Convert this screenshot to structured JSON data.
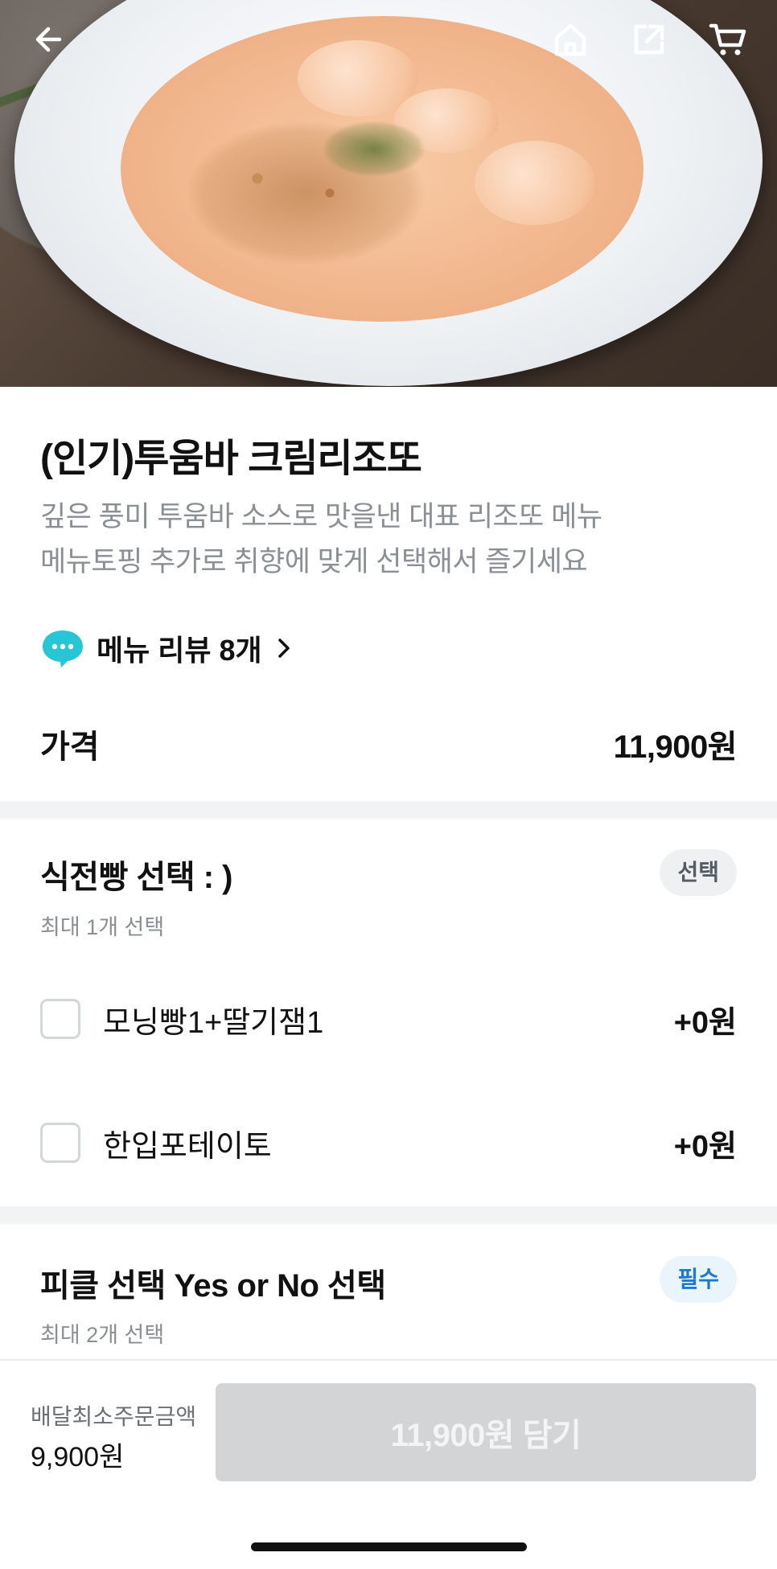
{
  "header": {
    "back_icon": "arrow-left-icon",
    "home_icon": "home-icon",
    "share_icon": "share-external-icon",
    "cart_icon": "cart-icon"
  },
  "product": {
    "title": "(인기)투움바 크림리조또",
    "description_lines": [
      "깊은 풍미 투움바 소스로 맛을낸 대표 리조또 메뉴",
      "메뉴토핑 추가로  취향에 맞게 선택해서 즐기세요"
    ],
    "review_label": "메뉴 리뷰 8개",
    "price_label": "가격",
    "price_value": "11,900원"
  },
  "option_groups": [
    {
      "title": "식전빵 선택 : )",
      "subtitle": "최대 1개 선택",
      "badge": "선택",
      "options": [
        {
          "label": "모닝빵1+딸기잼1",
          "price": "+0원",
          "checked": false
        },
        {
          "label": "한입포테이토",
          "price": "+0원",
          "checked": false
        }
      ]
    },
    {
      "title": "피클 선택 Yes or No 선택",
      "subtitle": "최대 2개 선택",
      "badge": "필수"
    }
  ],
  "footer": {
    "min_order_label": "배달최소주문금액",
    "min_order_value": "9,900원",
    "cart_button_label": "11,900원 담기"
  },
  "colors": {
    "required_badge_text": "#1d7ad0",
    "required_badge_bg": "#eaf4fc",
    "review_icon": "#27c6d6",
    "disabled_button": "#d3d4d6"
  }
}
